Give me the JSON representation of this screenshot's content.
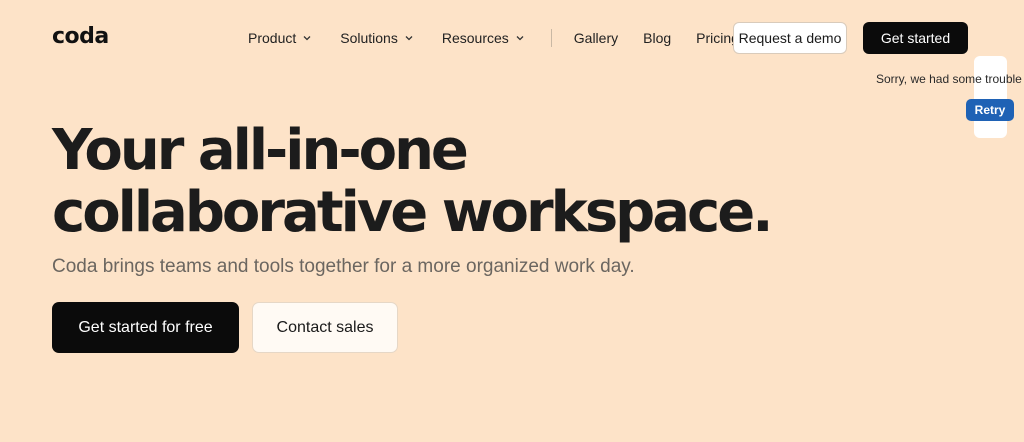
{
  "brand": {
    "logo_text": "coda"
  },
  "nav": {
    "items": [
      {
        "label": "Product",
        "has_dropdown": true
      },
      {
        "label": "Solutions",
        "has_dropdown": true
      },
      {
        "label": "Resources",
        "has_dropdown": true
      },
      {
        "label": "Gallery",
        "has_dropdown": false
      },
      {
        "label": "Blog",
        "has_dropdown": false
      },
      {
        "label": "Pricing",
        "has_dropdown": false
      }
    ],
    "request_demo_label": "Request a demo",
    "get_started_label": "Get started"
  },
  "error_widget": {
    "message": "Sorry, we had some trouble",
    "retry_label": "Retry"
  },
  "hero": {
    "headline_line1": "Your all-in-one",
    "headline_line2": "collaborative workspace.",
    "subheadline": "Coda brings teams and tools together for a more organized work day.",
    "primary_cta": "Get started for free",
    "secondary_cta": "Contact sales"
  },
  "colors": {
    "background": "#fde3c8",
    "primary_button": "#0b0b0b",
    "retry_button": "#1f62b5"
  }
}
